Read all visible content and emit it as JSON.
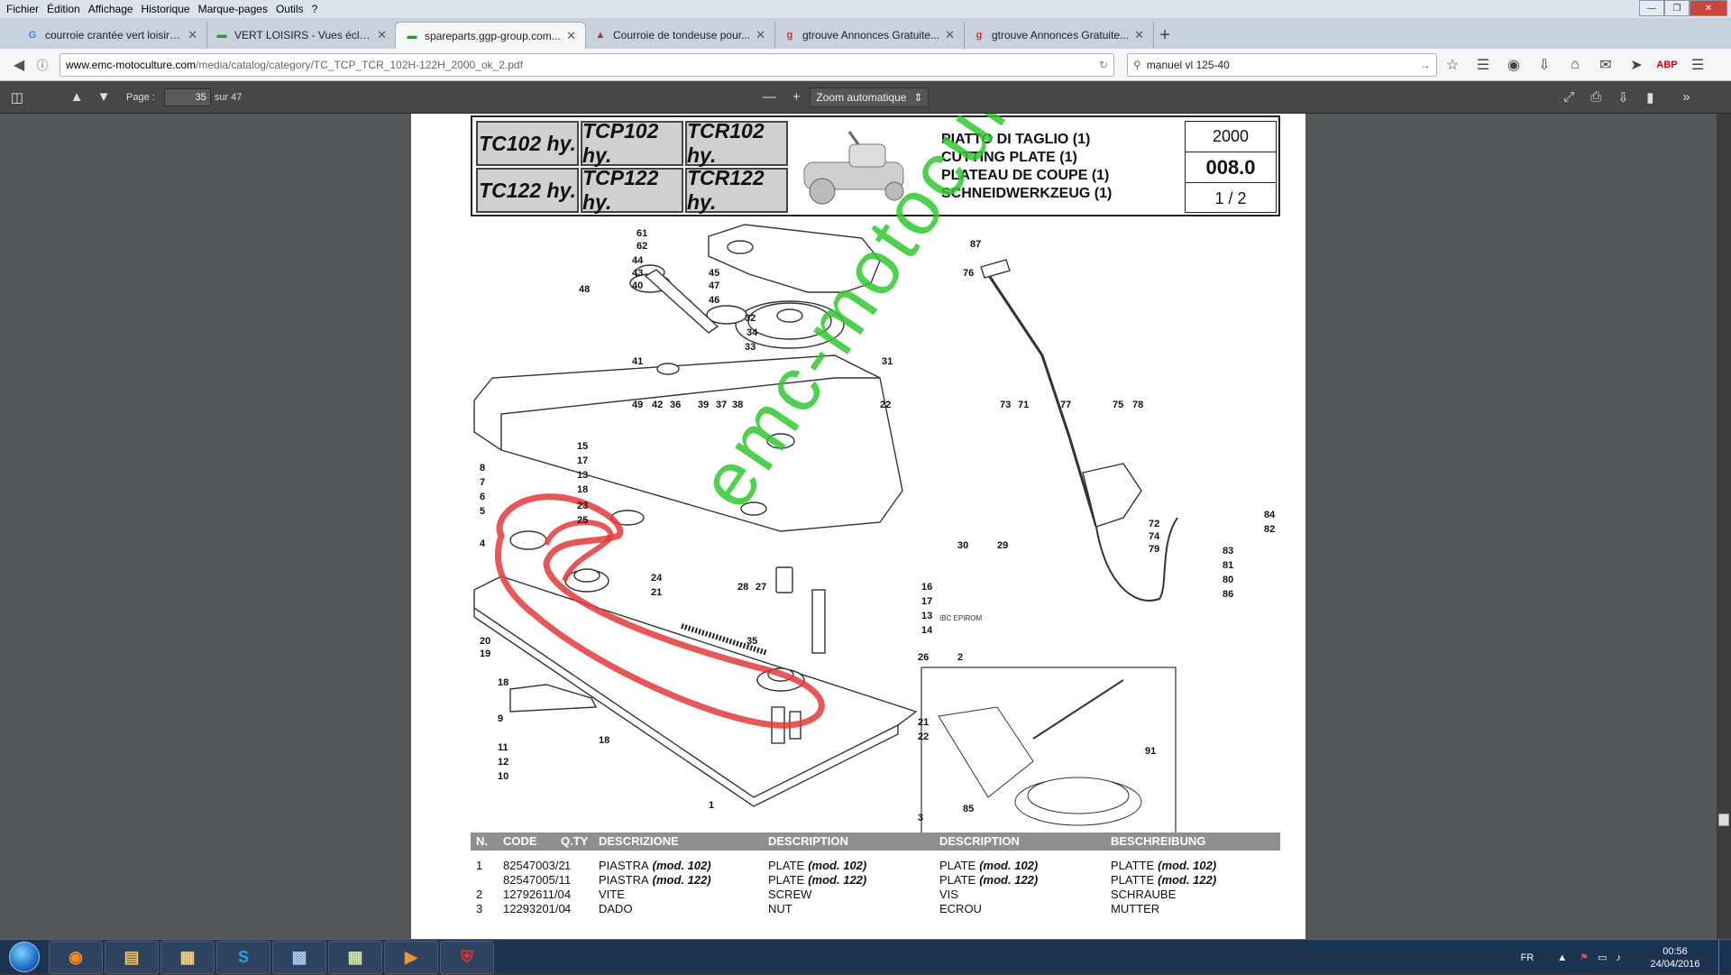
{
  "menubar": {
    "items": [
      "Fichier",
      "Édition",
      "Affichage",
      "Historique",
      "Marque-pages",
      "Outils",
      "?"
    ]
  },
  "tabs": [
    {
      "title": "courroie crantée vert loisirs...",
      "icon": "google-icon"
    },
    {
      "title": "VERT LOISIRS - Vues éclatées",
      "icon": "ggp-icon"
    },
    {
      "title": "spareparts.ggp-group.com...",
      "icon": "ggp-icon",
      "active": true
    },
    {
      "title": "Courroie de tondeuse pour...",
      "icon": "mower-icon"
    },
    {
      "title": "gtrouve Annonces Gratuite...",
      "icon": "gtrouve-icon"
    },
    {
      "title": "gtrouve Annonces Gratuite...",
      "icon": "gtrouve-icon"
    }
  ],
  "nav": {
    "url_domain": "www.emc-motoculture.com",
    "url_path": "/media/catalog/category/TC_TCP_TCR_102H-122H_2000_ok_2.pdf",
    "search": "manuel vl 125-40"
  },
  "pdf": {
    "page_label": "Page :",
    "page": "35",
    "total": "sur 47",
    "zoom": "Zoom automatique"
  },
  "doc": {
    "models": [
      "TC102 hy.",
      "TCP102 hy.",
      "TCR102 hy.",
      "TC122 hy.",
      "TCP122 hy.",
      "TCR122 hy."
    ],
    "titles": [
      "PIATTO DI TAGLIO (1)",
      "CUTTING PLATE (1)",
      "PLATEAU DE COUPE (1)",
      "SCHNEIDWERKZEUG (1)"
    ],
    "year": "2000",
    "code": "008.0",
    "pageof": "1 / 2",
    "stamp": "IBC EPIROM",
    "headers": [
      "N.",
      "CODE",
      "Q.TY",
      "DESCRIZIONE",
      "DESCRIPTION",
      "DESCRIPTION",
      "BESCHREIBUNG"
    ],
    "rows": [
      {
        "n": "1",
        "code": "82547003/2",
        "qty": "1",
        "it": "PIASTRA",
        "en": "PLATE",
        "fr": "PLATE",
        "de": "PLATTE",
        "mod": "(mod. 102)"
      },
      {
        "n": "",
        "code": "82547005/1",
        "qty": "1",
        "it": "PIASTRA",
        "en": "PLATE",
        "fr": "PLATE",
        "de": "PLATTE",
        "mod": "(mod. 122)"
      },
      {
        "n": "2",
        "code": "12792611/0",
        "qty": "4",
        "it": "VITE",
        "en": "SCREW",
        "fr": "VIS",
        "de": "SCHRAUBE",
        "mod": ""
      },
      {
        "n": "3",
        "code": "12293201/0",
        "qty": "4",
        "it": "DADO",
        "en": "NUT",
        "fr": "ECROU",
        "de": "MUTTER",
        "mod": ""
      }
    ],
    "watermark": "emc-motoculture.com"
  },
  "callouts": [
    "61",
    "62",
    "44",
    "43",
    "40",
    "45",
    "47",
    "46",
    "48",
    "87",
    "76",
    "32",
    "34",
    "33",
    "31",
    "41",
    "49",
    "42",
    "36",
    "39",
    "37",
    "38",
    "22",
    "73",
    "71",
    "77",
    "75",
    "78",
    "15",
    "17",
    "13",
    "18",
    "8",
    "7",
    "6",
    "5",
    "23",
    "25",
    "4",
    "24",
    "21",
    "72",
    "74",
    "79",
    "84",
    "82",
    "83",
    "81",
    "80",
    "86",
    "30",
    "29",
    "28",
    "27",
    "35",
    "16",
    "17",
    "13",
    "14",
    "26",
    "20",
    "19",
    "18",
    "9",
    "11",
    "12",
    "10",
    "2",
    "21",
    "22",
    "1",
    "18",
    "3",
    "85",
    "91"
  ],
  "taskbar": {
    "lang": "FR",
    "time": "00:56",
    "date": "24/04/2016"
  }
}
